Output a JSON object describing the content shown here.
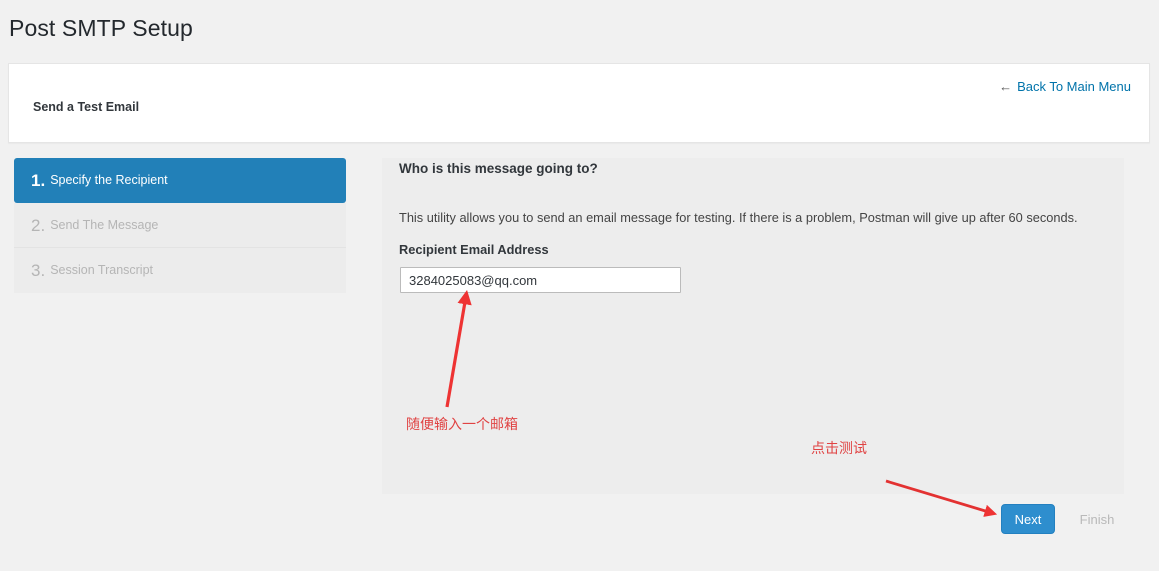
{
  "page": {
    "title": "Post SMTP Setup"
  },
  "header": {
    "card_title": "Send a Test Email",
    "back_link": "Back To Main Menu",
    "back_arrow_glyph": "←"
  },
  "steps": [
    {
      "num": "1.",
      "label": "Specify the Recipient",
      "active": true
    },
    {
      "num": "2.",
      "label": "Send The Message",
      "active": false
    },
    {
      "num": "3.",
      "label": "Session Transcript",
      "active": false
    }
  ],
  "main": {
    "heading": "Who is this message going to?",
    "description": "This utility allows you to send an email message for testing. If there is a problem, Postman will give up after 60 seconds.",
    "field_label": "Recipient Email Address",
    "recipient_value": "3284025083@qq.com",
    "recipient_placeholder": ""
  },
  "footer": {
    "next_label": "Next",
    "finish_label": "Finish"
  },
  "annotations": [
    {
      "text": "随便输入一个邮箱"
    },
    {
      "text": "点击测试"
    }
  ],
  "colors": {
    "accent_blue": "#2280b8",
    "button_blue": "#2e8ece",
    "link_blue": "#0073aa",
    "annotation_red": "#e04343",
    "page_bg": "#f1f1f1",
    "panel_bg": "#ededed",
    "step_bg": "#ececec"
  }
}
